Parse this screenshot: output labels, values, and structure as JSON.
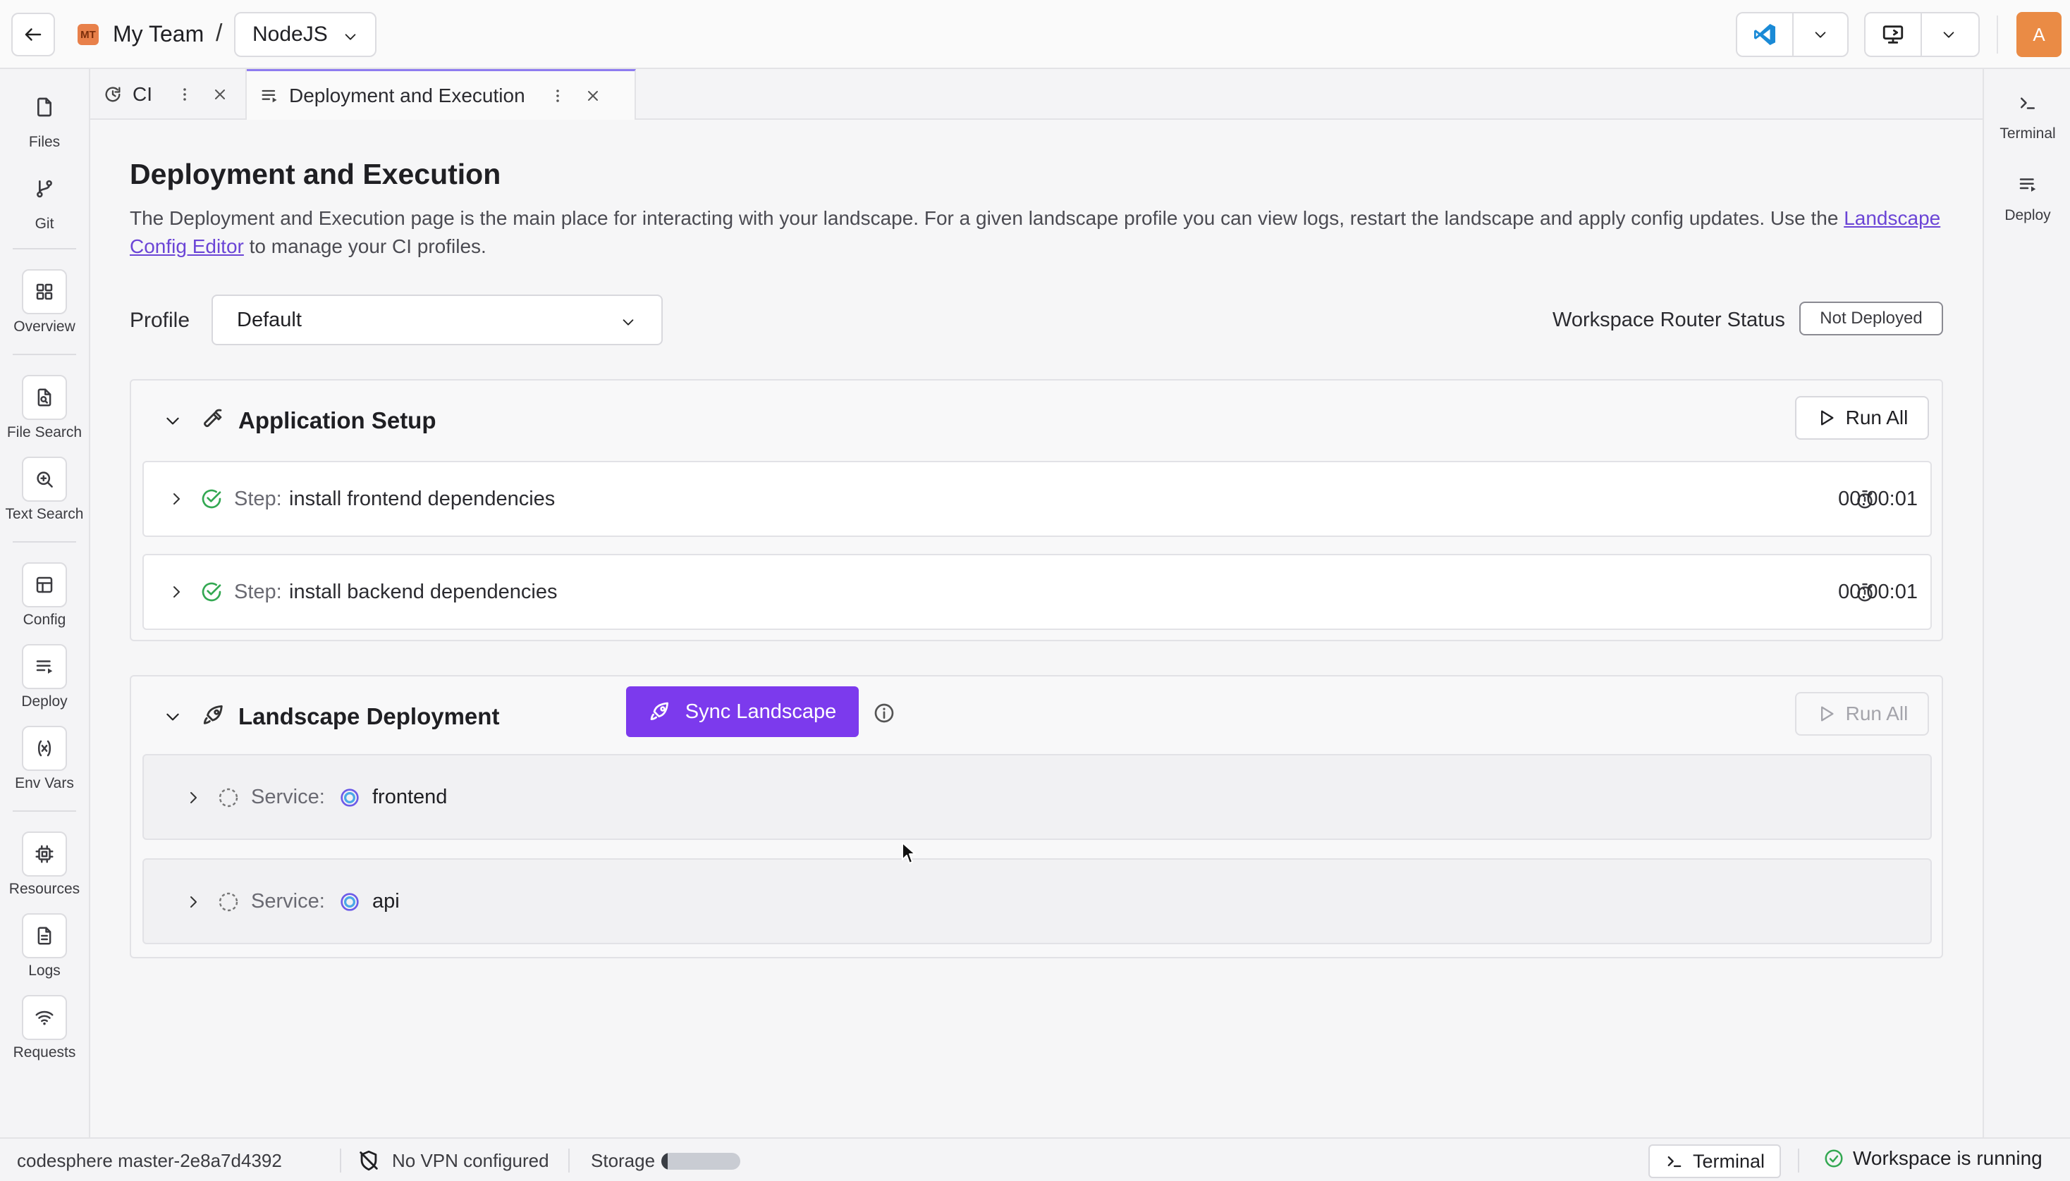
{
  "header": {
    "team_initials": "MT",
    "team_name": "My Team",
    "separator": "/",
    "project": "NodeJS",
    "avatar_initial": "A"
  },
  "left_nav": [
    {
      "label": "Files",
      "icon": "file-icon"
    },
    {
      "label": "Git",
      "icon": "git-branch-icon"
    },
    {
      "label": "Overview",
      "icon": "grid-icon"
    },
    {
      "label": "File Search",
      "icon": "file-search-icon"
    },
    {
      "label": "Text Search",
      "icon": "text-search-icon"
    },
    {
      "label": "Config",
      "icon": "config-icon"
    },
    {
      "label": "Deploy",
      "icon": "deploy-icon"
    },
    {
      "label": "Env Vars",
      "icon": "variable-icon"
    },
    {
      "label": "Resources",
      "icon": "chip-icon"
    },
    {
      "label": "Logs",
      "icon": "document-icon"
    },
    {
      "label": "Requests",
      "icon": "wifi-icon"
    }
  ],
  "right_nav": [
    {
      "label": "Terminal",
      "icon": "terminal-icon"
    },
    {
      "label": "Deploy",
      "icon": "deploy-icon"
    }
  ],
  "tabs": [
    {
      "label": "CI",
      "icon": "refresh-icon",
      "active": false
    },
    {
      "label": "Deployment and Execution",
      "icon": "deploy-icon",
      "active": true
    }
  ],
  "page": {
    "title": "Deployment and Execution",
    "description_before": "The Deployment and Execution page is the main place for interacting with your landscape. For a given landscape profile you can view logs, restart the landscape and apply config updates. Use the ",
    "description_link": "Landscape Config Editor",
    "description_after": " to manage your CI profiles.",
    "profile_label": "Profile",
    "profile_value": "Default",
    "router_label": "Workspace Router Status",
    "router_status": "Not Deployed"
  },
  "application_setup": {
    "title": "Application Setup",
    "run_all": "Run All",
    "step_prefix": "Step:",
    "steps": [
      {
        "name": "install frontend dependencies",
        "duration": "00:00:01",
        "status": "success"
      },
      {
        "name": "install backend dependencies",
        "duration": "00:00:01",
        "status": "success"
      }
    ]
  },
  "landscape_deployment": {
    "title": "Landscape Deployment",
    "sync_label": "Sync Landscape",
    "run_all": "Run All",
    "service_prefix": "Service:",
    "services": [
      {
        "name": "frontend",
        "status": "pending"
      },
      {
        "name": "api",
        "status": "pending"
      }
    ]
  },
  "statusbar": {
    "version": "codesphere master-2e8a7d4392",
    "vpn": "No VPN configured",
    "storage_label": "Storage",
    "storage_used_fraction": 0.08,
    "terminal_label": "Terminal",
    "workspace_status": "Workspace is running"
  },
  "colors": {
    "accent": "#7c3aed",
    "success": "#33a852",
    "avatar": "#ea8b45"
  }
}
